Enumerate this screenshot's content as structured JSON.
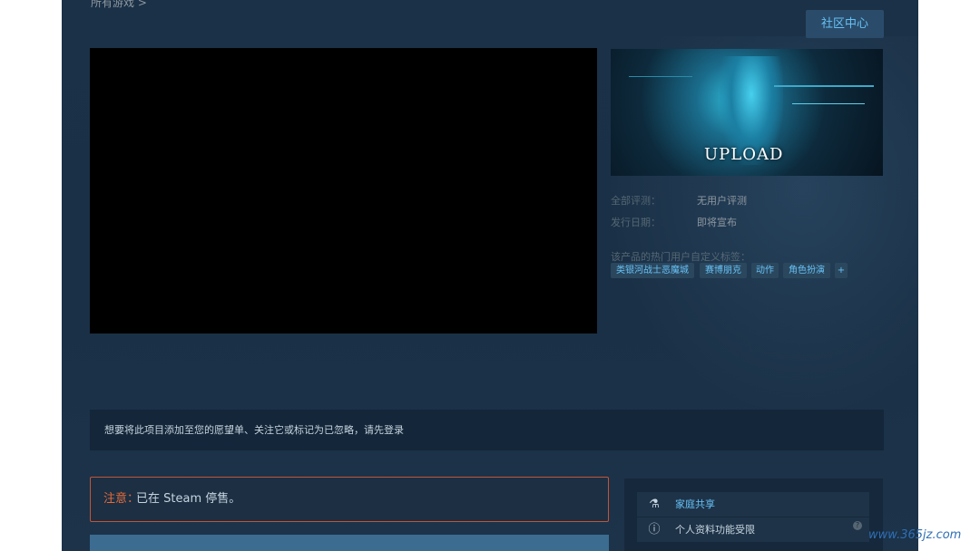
{
  "breadcrumb": "所有游戏 >",
  "community_button": "社区中心",
  "capsule": {
    "logo_text": "UPLOAD"
  },
  "info": {
    "reviews_label": "全部评测：",
    "reviews_value": "无用户评测",
    "release_label": "发行日期：",
    "release_value": "即将宣布"
  },
  "tags": {
    "label": "该产品的热门用户自定义标签：",
    "items": [
      "类银河战士恶魔城",
      "赛博朋克",
      "动作",
      "角色扮演",
      "+"
    ]
  },
  "login_bar": {
    "text": "想要将此项目添加至您的愿望单、关注它或标记为已忽略，请先登录"
  },
  "notice": {
    "label": "注意：",
    "text": "已在 Steam 停售。"
  },
  "features": [
    {
      "icon": "family-share-icon",
      "label": "家庭共享",
      "color": "#67c1f5"
    },
    {
      "icon": "info-icon",
      "label": "个人资料功能受限",
      "color": "#c6d4df"
    }
  ],
  "watermark": "www.365jz.com"
}
